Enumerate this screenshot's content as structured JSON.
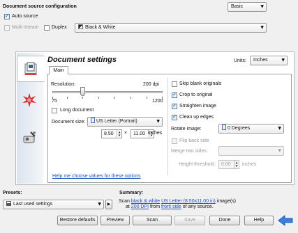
{
  "header": {
    "title": "Document source configuration",
    "mode_select": "Basic",
    "auto_source_label": "Auto source",
    "auto_source_checked": true,
    "multistream_label": "Multi-stream",
    "duplex_label": "Duplex",
    "color_mode": "Black & White"
  },
  "panel": {
    "title": "Document settings",
    "units_label": "Units:",
    "units_value": "Inches",
    "tab_main": "Main"
  },
  "resolution": {
    "label": "Resolution:",
    "value_display": "200 dpi",
    "min": "75",
    "max": "1200",
    "value": 200
  },
  "long_document_label": "Long document",
  "document_size": {
    "label": "Document size:",
    "value": "US Letter (Portrait)",
    "width": "8.50",
    "times": "×",
    "height": "11.00",
    "unit": "inches"
  },
  "options": {
    "skip_blank": "Skip blank originals",
    "crop": "Crop to original",
    "straighten": "Straighten image",
    "clean_edges": "Clean up edges",
    "rotate_label": "Rotate image:",
    "rotate_value": "0 Degrees",
    "flip_back": "Flip back side",
    "merge_label": "Merge two sides:",
    "height_threshold_label": "Height threshold:",
    "height_threshold_value": "0.00",
    "height_threshold_unit": "inches"
  },
  "help_link": "Help me choose values for these options",
  "presets": {
    "label": "Presets:",
    "value": "Last used settings"
  },
  "summary": {
    "label": "Summary:",
    "scan": "Scan",
    "color_link": "black & white",
    "size_link": "US Letter (8.50x11.00 in)",
    "image_suffix": "image(s)",
    "at": "at",
    "dpi_link": "200 DPI",
    "from": "from",
    "side_link": "front side",
    "tail": "of any source."
  },
  "buttons": {
    "restore": "Restore defaults",
    "preview": "Preview",
    "scan": "Scan",
    "save": "Save",
    "done": "Done",
    "help": "Help"
  },
  "colors": {
    "accent": "#1a4fc4",
    "back_arrow": "#3b7fe0"
  }
}
